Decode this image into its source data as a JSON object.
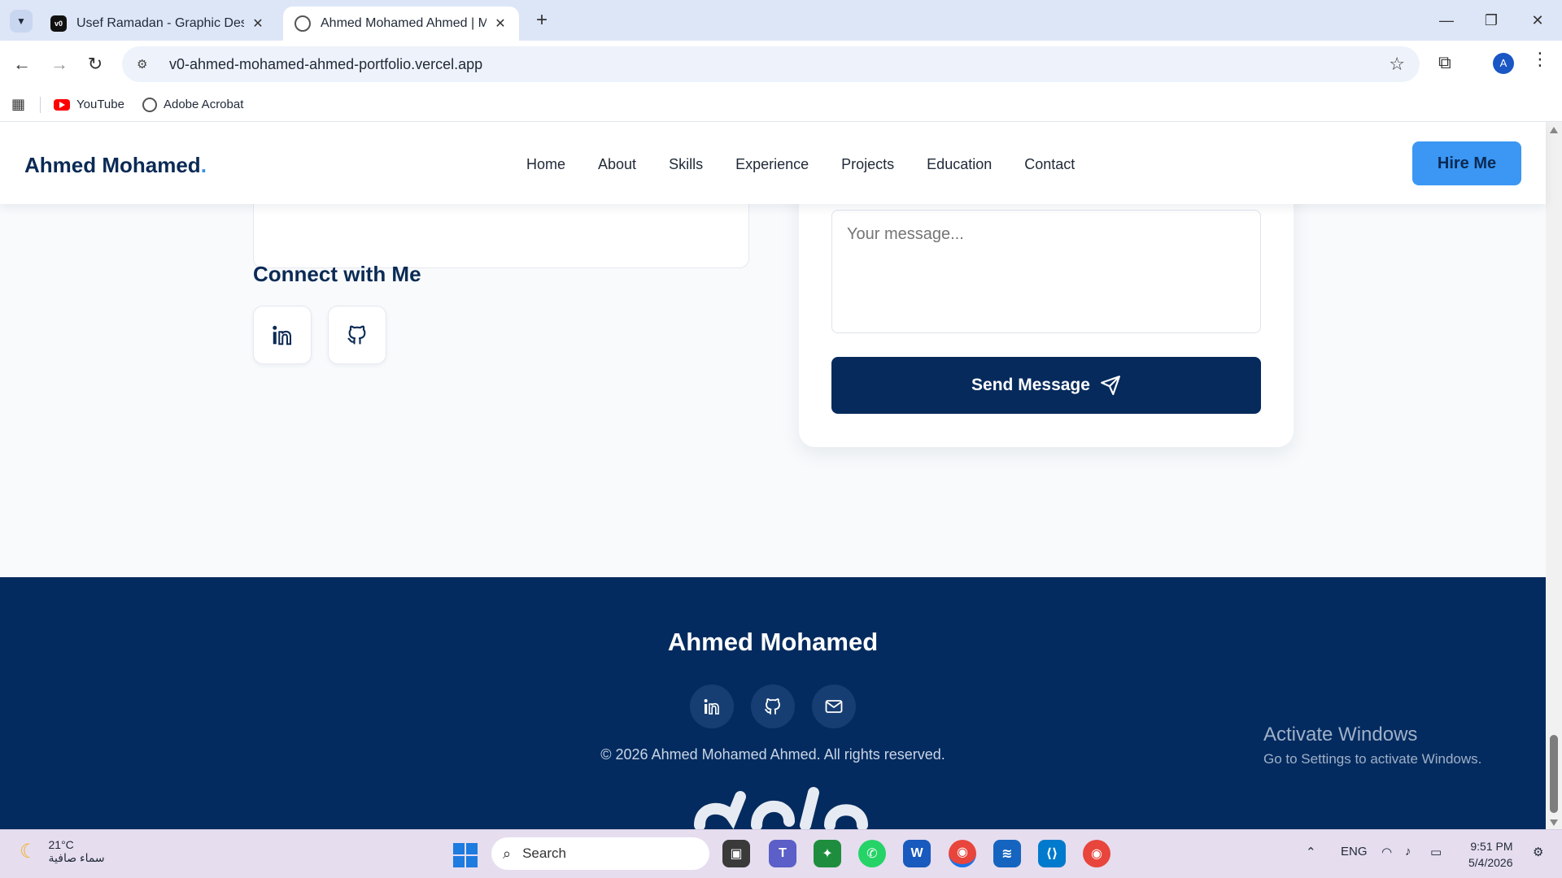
{
  "browser": {
    "tabs": [
      {
        "title": "Usef Ramadan - Graphic Designer",
        "favicon": "v0",
        "active": false
      },
      {
        "title": "Ahmed Mohamed Ahmed | Mac",
        "favicon": "globe-icon",
        "active": true
      }
    ],
    "url": "v0-ahmed-mohamed-ahmed-portfolio.vercel.app",
    "profile_initial": "A",
    "bookmarks": [
      {
        "label": "YouTube"
      },
      {
        "label": "Adobe Acrobat"
      }
    ]
  },
  "site": {
    "brand": "Ahmed Mohamed",
    "brand_dot": ".",
    "nav": [
      "Home",
      "About",
      "Skills",
      "Experience",
      "Projects",
      "Education",
      "Contact"
    ],
    "hire_label": "Hire Me",
    "connect_title": "Connect with Me",
    "message_placeholder": "Your message...",
    "send_label": "Send Message",
    "footer_name": "Ahmed Mohamed",
    "copyright": "© 2026 Ahmed Mohamed Ahmed. All rights reserved."
  },
  "overlay": {
    "activate_title": "Activate Windows",
    "activate_sub": "Go to Settings to activate Windows."
  },
  "taskbar": {
    "temperature": "21°C",
    "weather_desc": "سماء صافية",
    "search_label": "Search",
    "language": "ENG",
    "time": "9:51 PM",
    "date": "5/4/2026"
  },
  "colors": {
    "navy": "#062a5c",
    "footer": "#042b5f",
    "accent": "#3b97f3"
  }
}
